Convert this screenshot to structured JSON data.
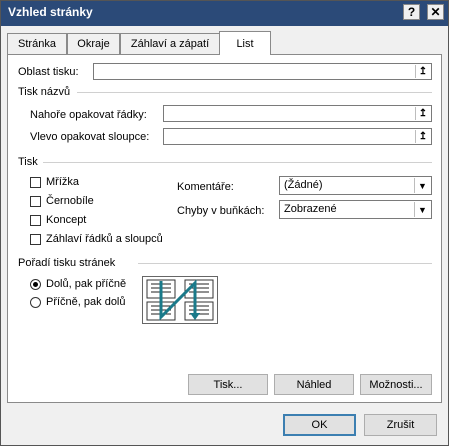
{
  "window": {
    "title": "Vzhled stránky",
    "help_glyph": "?",
    "close_glyph": "✕"
  },
  "tabs": [
    {
      "label": "Stránka"
    },
    {
      "label": "Okraje"
    },
    {
      "label": "Záhlaví a zápatí"
    },
    {
      "label": "List",
      "active": true
    }
  ],
  "print_area": {
    "label": "Oblast tisku:",
    "value": "",
    "collapse_glyph": "↥"
  },
  "print_titles": {
    "heading": "Tisk názvů",
    "rows_label": "Nahoře opakovat řádky:",
    "rows_value": "",
    "cols_label": "Vlevo opakovat sloupce:",
    "cols_value": ""
  },
  "print": {
    "heading": "Tisk",
    "checkboxes": [
      {
        "label": "Mřížka",
        "checked": false
      },
      {
        "label": "Černobíle",
        "checked": false
      },
      {
        "label": "Koncept",
        "checked": false
      },
      {
        "label": "Záhlaví řádků a sloupců",
        "checked": false
      }
    ],
    "comments_label": "Komentáře:",
    "comments_value": "(Žádné)",
    "errors_label": "Chyby v buňkách:",
    "errors_value": "Zobrazené",
    "dropdown_glyph": "▼"
  },
  "page_order": {
    "heading": "Pořadí tisku stránek",
    "options": [
      {
        "label": "Dolů, pak příčně",
        "selected": true
      },
      {
        "label": "Příčně, pak dolů",
        "selected": false
      }
    ]
  },
  "buttons": {
    "print": "Tisk...",
    "preview": "Náhled",
    "options": "Možnosti...",
    "ok": "OK",
    "cancel": "Zrušit"
  },
  "colors": {
    "titlebar": "#2b4a78",
    "default_button_border": "#3c7fb1",
    "order_arrow": "#1a7a8a"
  }
}
